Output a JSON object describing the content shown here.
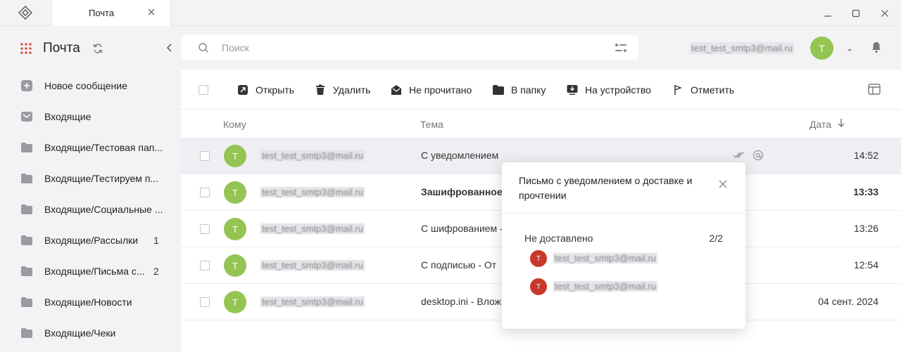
{
  "window": {
    "tab_title": "Почта"
  },
  "sidebar": {
    "title": "Почта",
    "items": [
      {
        "label": "Новое сообщение",
        "icon": "plus-icon",
        "count": ""
      },
      {
        "label": "Входящие",
        "icon": "inbox-icon",
        "count": ""
      },
      {
        "label": "Входящие/Тестовая пап...",
        "icon": "folder-icon",
        "count": ""
      },
      {
        "label": "Входящие/Тестируем п...",
        "icon": "folder-icon",
        "count": ""
      },
      {
        "label": "Входящие/Социальные ...",
        "icon": "folder-icon",
        "count": ""
      },
      {
        "label": "Входящие/Рассылки",
        "icon": "folder-icon",
        "count": "1"
      },
      {
        "label": "Входящие/Письма с...",
        "icon": "folder-icon",
        "count": "2"
      },
      {
        "label": "Входящие/Новости",
        "icon": "folder-icon",
        "count": ""
      },
      {
        "label": "Входящие/Чеки",
        "icon": "folder-icon",
        "count": ""
      }
    ]
  },
  "search": {
    "placeholder": "Поиск"
  },
  "user": {
    "email": "test_test_smtp3@mail.ru",
    "avatar_letter": "T"
  },
  "toolbar": {
    "open": "Открыть",
    "delete": "Удалить",
    "unread": "Не прочитано",
    "to_folder": "В папку",
    "to_device": "На устройство",
    "mark": "Отметить"
  },
  "columns": {
    "to": "Кому",
    "subject": "Тема",
    "date": "Дата"
  },
  "messages": [
    {
      "avatar": "T",
      "to": "test_test_smtp3@mail.ru",
      "subject": "С уведомлением",
      "date": "14:52",
      "bold": false,
      "selected": true
    },
    {
      "avatar": "T",
      "to": "test_test_smtp3@mail.ru",
      "subject": "Зашифрованное п",
      "date": "13:33",
      "bold": true,
      "selected": false
    },
    {
      "avatar": "T",
      "to": "test_test_smtp3@mail.ru",
      "subject": "С шифрованием -",
      "date": "13:26",
      "bold": false,
      "selected": false
    },
    {
      "avatar": "T",
      "to": "test_test_smtp3@mail.ru",
      "subject": "С подписью -  От",
      "date": "12:54",
      "bold": false,
      "selected": false
    },
    {
      "avatar": "T",
      "to": "test_test_smtp3@mail.ru",
      "subject": "desktop.ini - Влож",
      "date": "04 сент. 2024",
      "bold": false,
      "selected": false
    }
  ],
  "popup": {
    "title": "Письмо с уведомлением о доставке и прочтении",
    "status": "Не доставлено",
    "count": "2/2",
    "recipients": [
      {
        "avatar": "T",
        "email": "test_test_smtp3@mail.ru"
      },
      {
        "avatar": "T",
        "email": "test_test_smtp3@mail.ru"
      }
    ]
  },
  "colors": {
    "avatar_green": "#94c452",
    "avatar_red": "#c8392b",
    "sidebar_bg": "#f3f3f6"
  }
}
